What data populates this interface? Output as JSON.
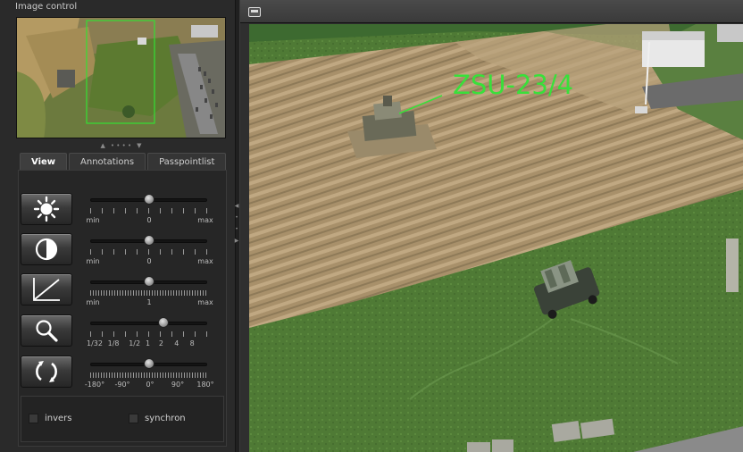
{
  "panel": {
    "title": "Image control"
  },
  "tabs": [
    {
      "label": "View",
      "active": true
    },
    {
      "label": "Annotations",
      "active": false
    },
    {
      "label": "Passpointlist",
      "active": false
    }
  ],
  "tools": [
    {
      "icon": "brightness-icon"
    },
    {
      "icon": "contrast-icon"
    },
    {
      "icon": "gamma-curve-icon"
    },
    {
      "icon": "zoom-icon"
    },
    {
      "icon": "rotate-icon"
    }
  ],
  "sliders": {
    "brightness": {
      "fraction": 0.5,
      "min_label": "min",
      "mid_label": "0",
      "max_label": "max"
    },
    "contrast": {
      "fraction": 0.5,
      "min_label": "min",
      "mid_label": "0",
      "max_label": "max"
    },
    "gamma": {
      "fraction": 0.5,
      "min_label": "min",
      "mid_label": "1",
      "max_label": "max"
    },
    "zoom": {
      "fraction": 0.625,
      "labels": [
        "1/32",
        "1/8",
        "1/2",
        "1",
        "2",
        "4",
        "8"
      ]
    },
    "rotation": {
      "fraction": 0.5,
      "labels": [
        "-180°",
        "-90°",
        "0°",
        "90°",
        "180°"
      ]
    }
  },
  "checkboxes": {
    "invers": {
      "label": "invers",
      "checked": false
    },
    "synchron": {
      "label": "synchron",
      "checked": false
    }
  },
  "annotation": {
    "label": "ZSU-23/4",
    "color": "#39e03a"
  },
  "colors": {
    "panel_bg": "#2a2a2a",
    "accent_green": "#39e03a"
  }
}
